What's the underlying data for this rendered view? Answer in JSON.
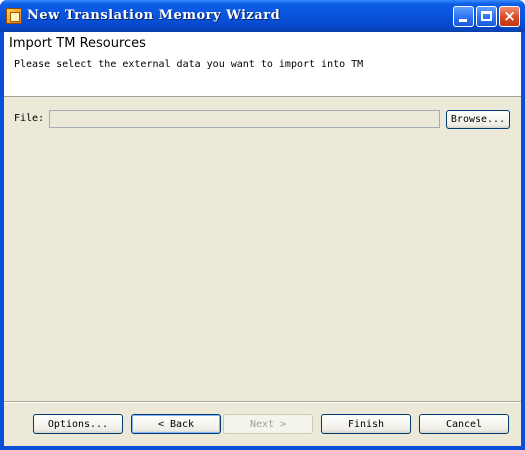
{
  "window": {
    "title": "New Translation Memory Wizard",
    "controls": {
      "minimize": "minimize-icon",
      "maximize": "maximize-icon",
      "close": "×"
    }
  },
  "header": {
    "title": "Import TM Resources",
    "description": "Please select the external data you want to import into TM"
  },
  "form": {
    "file_label": "File:",
    "file_value": "",
    "browse_label": "Browse..."
  },
  "footer": {
    "options_label": "Options...",
    "back_label": "< Back",
    "next_label": "Next >",
    "finish_label": "Finish",
    "cancel_label": "Cancel"
  },
  "colors": {
    "titlebar": "#0a54de",
    "client_bg": "#ece9d8",
    "header_bg": "#ffffff"
  }
}
